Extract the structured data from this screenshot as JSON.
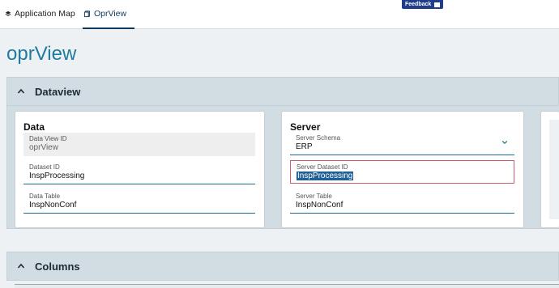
{
  "topbar": {
    "tabs": [
      {
        "label": "Application Map",
        "icon": "layers-icon"
      },
      {
        "label": "OprView",
        "icon": "document-icon"
      }
    ],
    "feedback_label": "Feedback"
  },
  "page_title": "oprView",
  "dataview": {
    "title": "Dataview",
    "data_card": {
      "title": "Data",
      "fields": [
        {
          "label": "Data View ID",
          "value": "oprView"
        },
        {
          "label": "Dataset ID",
          "value": "InspProcessing"
        },
        {
          "label": "Data Table",
          "value": "InspNonConf"
        }
      ]
    },
    "server_card": {
      "title": "Server",
      "fields": [
        {
          "label": "Server Schema",
          "value": "ERP"
        },
        {
          "label": "Server Dataset ID",
          "value": "InspProcessing"
        },
        {
          "label": "Server Table",
          "value": "InspNonConf"
        }
      ]
    }
  },
  "columns": {
    "title": "Columns"
  },
  "colors": {
    "accent": "#1f7ba0",
    "nav_active": "#0d3a5c",
    "focus_border": "#d25c6f",
    "selection": "#1f5f95"
  }
}
